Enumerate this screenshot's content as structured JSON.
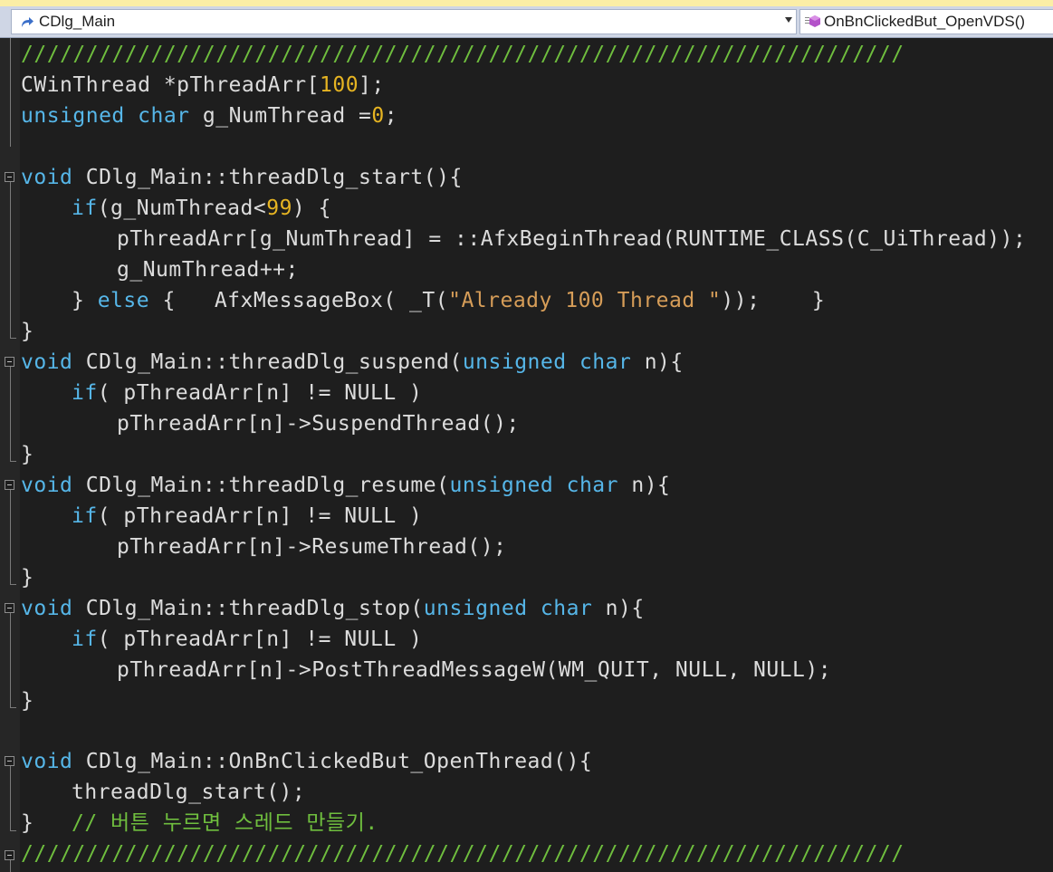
{
  "navbar": {
    "class_dropdown": "CDlg_Main",
    "member_dropdown": "OnBnClickedBut_OpenVDS()",
    "class_icon": "class-arrow-icon",
    "member_icon": "method-cube-icon"
  },
  "code": {
    "l1": "////////////////////////////////////////////////////////////////////",
    "l2_a": "CWinThread *pThreadArr[",
    "l2_num": "100",
    "l2_b": "];",
    "l3_kw1": "unsigned",
    "l3_kw2": "char",
    "l3_a": " g_NumThread =",
    "l3_num": "0",
    "l3_b": ";",
    "l5_kw": "void",
    "l5_a": " CDlg_Main::threadDlg_start(){",
    "l6_kw": "if",
    "l6_a": "(g_NumThread<",
    "l6_num": "99",
    "l6_b": ") {",
    "l7": "pThreadArr[g_NumThread] = ::AfxBeginThread(RUNTIME_CLASS(C_UiThread));",
    "l8": "g_NumThread++;",
    "l9_a": "} ",
    "l9_kw": "else",
    "l9_b": " {   AfxMessageBox( _T(",
    "l9_str": "\"Already 100 Thread \"",
    "l9_c": "));    }",
    "l10": "}",
    "l11_kw": "void",
    "l11_a": " CDlg_Main::threadDlg_suspend(",
    "l11_kw2": "unsigned",
    "l11_kw3": "char",
    "l11_b": " n){",
    "l12_kw": "if",
    "l12_a": "( pThreadArr[n] != NULL )",
    "l13": "pThreadArr[n]->SuspendThread();",
    "l14": "}",
    "l15_kw": "void",
    "l15_a": " CDlg_Main::threadDlg_resume(",
    "l15_kw2": "unsigned",
    "l15_kw3": "char",
    "l15_b": " n){",
    "l16_kw": "if",
    "l16_a": "( pThreadArr[n] != NULL )",
    "l17": "pThreadArr[n]->ResumeThread();",
    "l18": "}",
    "l19_kw": "void",
    "l19_a": " CDlg_Main::threadDlg_stop(",
    "l19_kw2": "unsigned",
    "l19_kw3": "char",
    "l19_b": " n){",
    "l20_kw": "if",
    "l20_a": "( pThreadArr[n] != NULL )",
    "l21": "pThreadArr[n]->PostThreadMessageW(WM_QUIT, NULL, NULL);",
    "l22": "}",
    "l24_kw": "void",
    "l24_a": " CDlg_Main::OnBnClickedBut_OpenThread(){",
    "l25": "threadDlg_start();",
    "l26_a": "}",
    "l26_cm": "// 버튼 누르면 스레드 만들기.",
    "l27": "////////////////////////////////////////////////////////////////////"
  },
  "colors": {
    "background": "#1e1e1e",
    "keyword": "#56b6e8",
    "number": "#e6b422",
    "string": "#d69d58",
    "comment": "#6fbe3e",
    "text": "#dcdcdc"
  }
}
